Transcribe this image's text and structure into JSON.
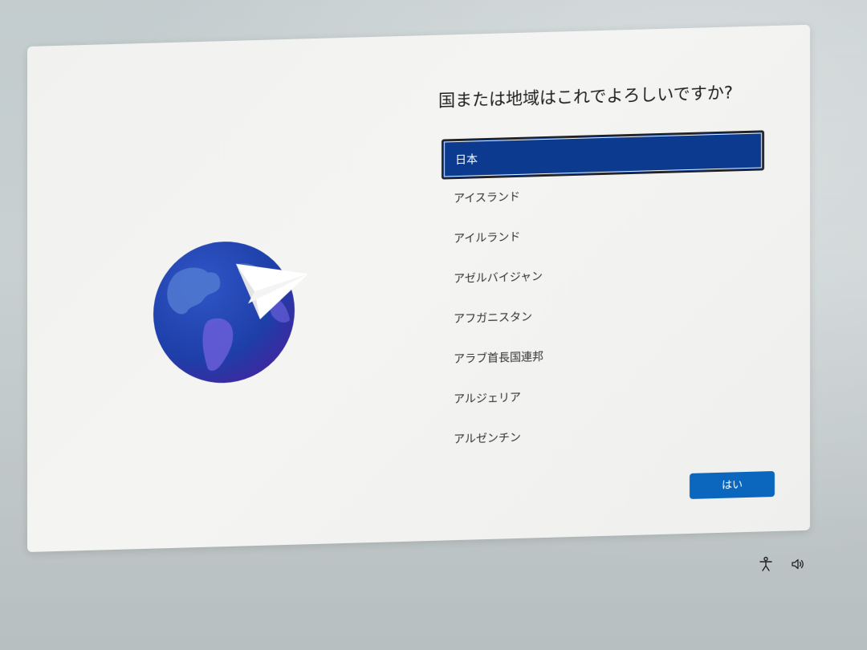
{
  "dialog": {
    "title": "国または地域はこれでよろしいですか?",
    "regions": [
      {
        "label": "日本",
        "selected": true
      },
      {
        "label": "アイスランド",
        "selected": false
      },
      {
        "label": "アイルランド",
        "selected": false
      },
      {
        "label": "アゼルバイジャン",
        "selected": false
      },
      {
        "label": "アフガニスタン",
        "selected": false
      },
      {
        "label": "アラブ首長国連邦",
        "selected": false
      },
      {
        "label": "アルジェリア",
        "selected": false
      },
      {
        "label": "アルゼンチン",
        "selected": false
      }
    ],
    "confirm_label": "はい"
  },
  "illustration": {
    "icon": "globe-with-paper-plane-icon"
  },
  "tray": {
    "accessibility_icon": "accessibility-icon",
    "volume_icon": "volume-icon"
  },
  "colors": {
    "selected_bg": "#0b3a8f",
    "button_bg": "#0b66bd",
    "globe_dark": "#1e3fa8",
    "globe_light": "#5a7fd6"
  }
}
